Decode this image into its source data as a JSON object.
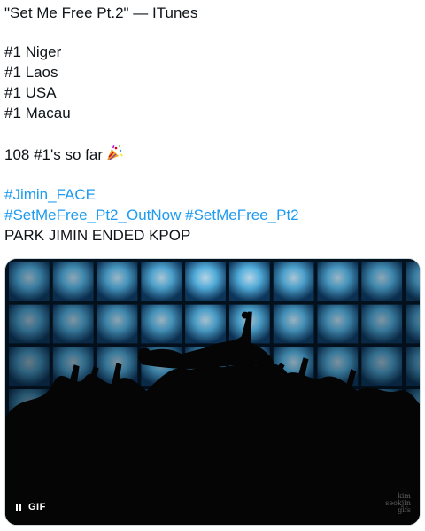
{
  "tweet": {
    "title_line": "\"Set Me Free Pt.2\" — ITunes",
    "rankings": [
      "#1 Niger",
      "#1 Laos",
      "#1 USA",
      "#1 Macau"
    ],
    "count_line": "108 #1's so far",
    "count_emoji": "party-popper-icon",
    "hashtags": {
      "line1": [
        "#Jimin_FACE"
      ],
      "line2": [
        "#SetMeFree_Pt2_OutNow",
        "#SetMeFree_Pt2"
      ]
    },
    "closing_line": "PARK JIMIN ENDED KPOP",
    "colors": {
      "hashtag": "#1d9bf0",
      "text": "#0f1419",
      "panel_glow": "#4fb8f0"
    }
  },
  "media": {
    "type": "gif",
    "badge_label": "GIF",
    "pause_icon": "pause-icon",
    "watermark": "kim seokjin gifs"
  }
}
